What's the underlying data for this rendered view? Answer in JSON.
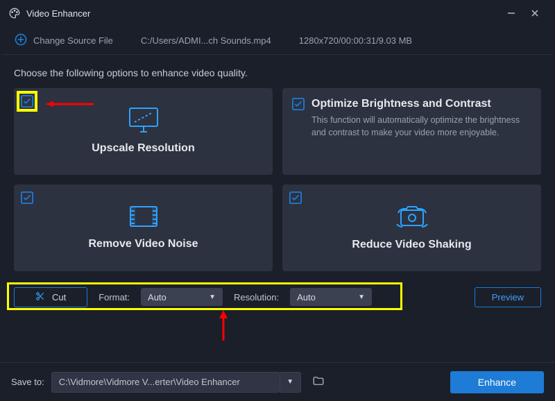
{
  "title": "Video Enhancer",
  "source": {
    "change_label": "Change Source File",
    "path": "C:/Users/ADMI...ch Sounds.mp4",
    "meta": "1280x720/00:00:31/9.03 MB"
  },
  "instruction": "Choose the following options to enhance video quality.",
  "cards": {
    "upscale": "Upscale Resolution",
    "optimize_title": "Optimize Brightness and Contrast",
    "optimize_desc": "This function will automatically optimize the brightness and contrast to make your video more enjoyable.",
    "noise": "Remove Video Noise",
    "shaking": "Reduce Video Shaking"
  },
  "controls": {
    "cut": "Cut",
    "format_label": "Format:",
    "format_value": "Auto",
    "resolution_label": "Resolution:",
    "resolution_value": "Auto",
    "preview": "Preview"
  },
  "footer": {
    "save_label": "Save to:",
    "path": "C:\\Vidmore\\Vidmore V...erter\\Video Enhancer",
    "enhance": "Enhance"
  }
}
